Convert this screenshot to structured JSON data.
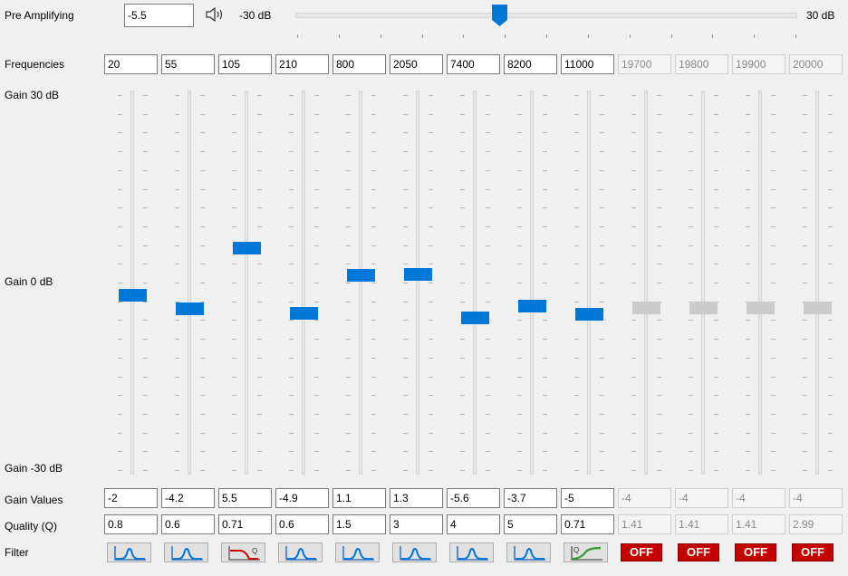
{
  "pre_amp": {
    "label": "Pre Amplifying",
    "value": "-5.5",
    "min_label": "-30 dB",
    "max_label": "30 dB",
    "min": -30,
    "max": 30,
    "level": -5.5,
    "icon": "speaker-icon"
  },
  "labels": {
    "frequencies": "Frequencies",
    "gain_top": "Gain 30 dB",
    "gain_mid": "Gain 0 dB",
    "gain_bottom": "Gain -30 dB",
    "gain_values": "Gain Values",
    "quality": "Quality (Q)",
    "filter": "Filter"
  },
  "bands": [
    {
      "freq": "20",
      "gain": "-2",
      "q": "0.8",
      "filter": "peak-filter-icon",
      "enabled": true,
      "level": -2
    },
    {
      "freq": "55",
      "gain": "-4.2",
      "q": "0.6",
      "filter": "peak-filter-icon",
      "enabled": true,
      "level": -4.2
    },
    {
      "freq": "105",
      "gain": "5.5",
      "q": "0.71",
      "filter": "high-pass-filter-icon",
      "enabled": true,
      "level": 5.5
    },
    {
      "freq": "210",
      "gain": "-4.9",
      "q": "0.6",
      "filter": "peak-filter-icon",
      "enabled": true,
      "level": -4.9
    },
    {
      "freq": "800",
      "gain": "1.1",
      "q": "1.5",
      "filter": "peak-filter-icon",
      "enabled": true,
      "level": 1.1
    },
    {
      "freq": "2050",
      "gain": "1.3",
      "q": "3",
      "filter": "peak-filter-icon",
      "enabled": true,
      "level": 1.3
    },
    {
      "freq": "7400",
      "gain": "-5.6",
      "q": "4",
      "filter": "peak-filter-icon",
      "enabled": true,
      "level": -5.6
    },
    {
      "freq": "8200",
      "gain": "-3.7",
      "q": "5",
      "filter": "peak-filter-icon",
      "enabled": true,
      "level": -3.7
    },
    {
      "freq": "11000",
      "gain": "-5",
      "q": "0.71",
      "filter": "low-pass-filter-icon",
      "enabled": true,
      "level": -5
    },
    {
      "freq": "19700",
      "gain": "-4",
      "q": "1.41",
      "filter": "OFF",
      "enabled": false,
      "level": -4
    },
    {
      "freq": "19800",
      "gain": "-4",
      "q": "1.41",
      "filter": "OFF",
      "enabled": false,
      "level": -4
    },
    {
      "freq": "19900",
      "gain": "-4",
      "q": "1.41",
      "filter": "OFF",
      "enabled": false,
      "level": -4
    },
    {
      "freq": "20000",
      "gain": "-4",
      "q": "2.99",
      "filter": "OFF",
      "enabled": false,
      "level": -4
    }
  ],
  "colors": {
    "thumb_active": "#0078d7",
    "thumb_disabled": "#cccccc",
    "off_button": "#c40000"
  }
}
